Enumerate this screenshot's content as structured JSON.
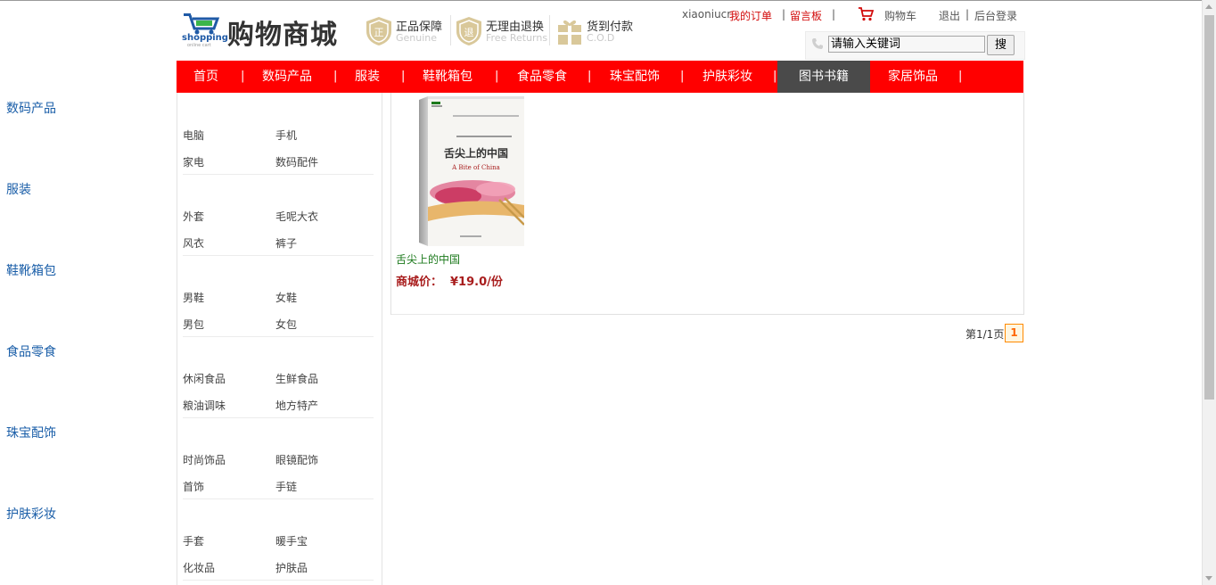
{
  "header": {
    "logo_text": "购物商城",
    "logo_sub": "shopping",
    "logo_sub2": "online cart",
    "features": [
      {
        "title": "正品保障",
        "subtitle": "Genuine",
        "icon": "shield-genuine-icon"
      },
      {
        "title": "无理由退换",
        "subtitle": "Free Returns",
        "icon": "shield-returns-icon"
      },
      {
        "title": "货到付款",
        "subtitle": "C.O.D",
        "icon": "gift-box-icon"
      }
    ],
    "user": {
      "username": "xiaoniucr",
      "my_orders": "我的订单",
      "sep1": "|",
      "guestbook": "留言板",
      "sep2": "|",
      "cart": "购物车",
      "logout": "退出",
      "sep3": "|",
      "admin_login": "后台登录"
    },
    "search": {
      "value": "请输入关键词",
      "button": "搜"
    }
  },
  "nav": {
    "items": [
      "首页",
      "数码产品",
      "服装",
      "鞋靴箱包",
      "食品零食",
      "珠宝配饰",
      "护肤彩妆",
      "图书书籍",
      "家居饰品"
    ],
    "separator": "|",
    "active": "图书书籍"
  },
  "sidebar": {
    "categories": [
      {
        "title": "数码产品",
        "items": [
          "电脑",
          "手机",
          "家电",
          "数码配件"
        ]
      },
      {
        "title": "服装",
        "items": [
          "外套",
          "毛呢大衣",
          "风衣",
          "裤子"
        ]
      },
      {
        "title": "鞋靴箱包",
        "items": [
          "男鞋",
          "女鞋",
          "男包",
          "女包"
        ]
      },
      {
        "title": "食品零食",
        "items": [
          "休闲食品",
          "生鲜食品",
          "粮油调味",
          "地方特产"
        ]
      },
      {
        "title": "珠宝配饰",
        "items": [
          "时尚饰品",
          "眼镜配饰",
          "首饰",
          "手链"
        ]
      },
      {
        "title": "护肤彩妆",
        "items": [
          "手套",
          "暖手宝",
          "化妆品",
          "护肤品"
        ]
      }
    ]
  },
  "products": [
    {
      "name": "舌尖上的中国",
      "price_label": "商城价：",
      "price": "¥19.0/份",
      "cover": {
        "title_cn": "舌尖上的中国",
        "title_en": "A Bite of China"
      }
    }
  ],
  "pager": {
    "text": "第1/1页",
    "current": "1"
  },
  "colors": {
    "nav_bg": "#ff0000",
    "nav_active_bg": "#4a4a4a",
    "category_title": "#1a5ea8",
    "price": "#a81d1d",
    "product_name": "#1d7a1d",
    "link_red": "#d20b0b"
  }
}
